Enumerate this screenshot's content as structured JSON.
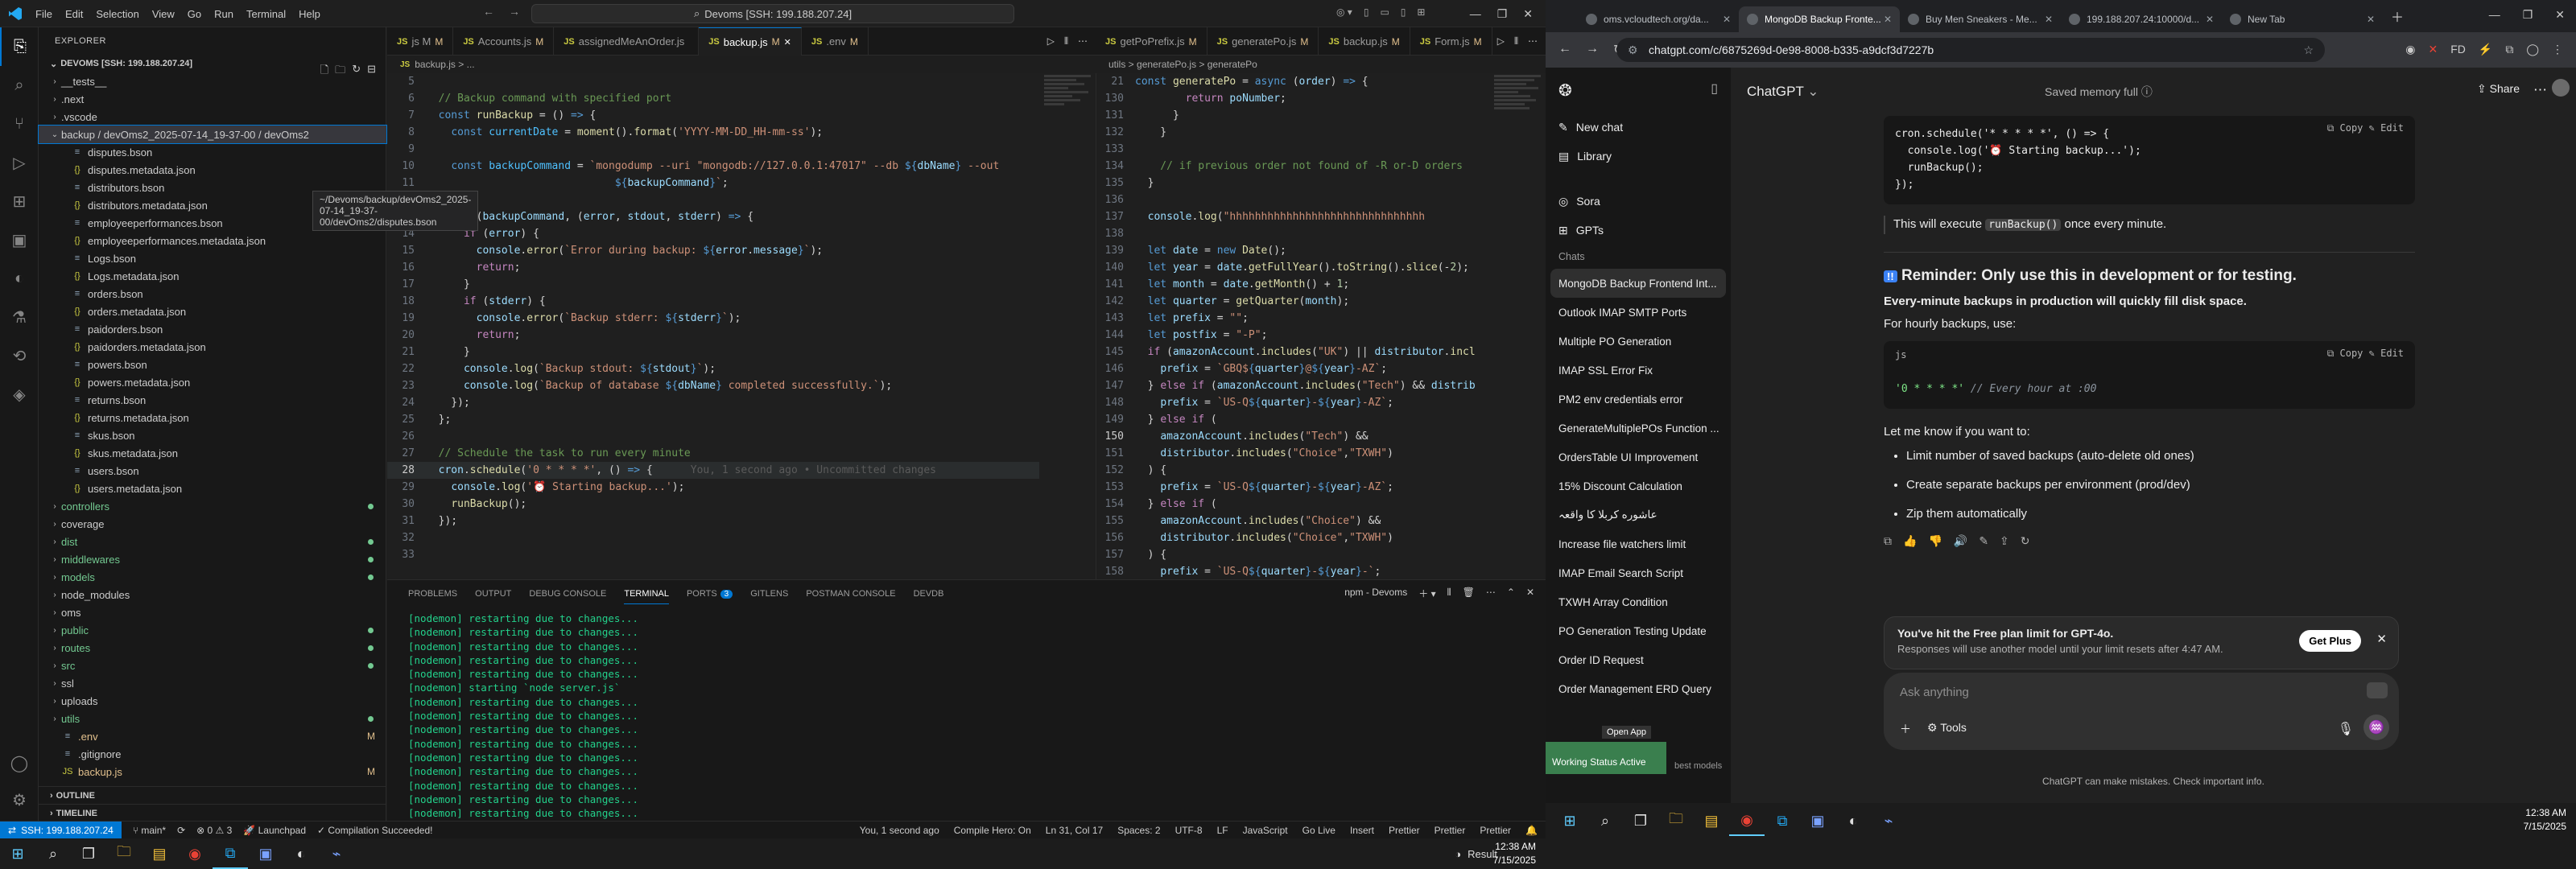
{
  "vscode": {
    "menu": [
      "File",
      "Edit",
      "Selection",
      "View",
      "Go",
      "Run",
      "Terminal",
      "Help"
    ],
    "command_center": "Devoms [SSH: 199.188.207.24]",
    "tabs": [
      {
        "label": "js M",
        "active": false,
        "mod": "M"
      },
      {
        "label": "Accounts.js",
        "active": false,
        "mod": "M"
      },
      {
        "label": "assignedMeAnOrder.js",
        "active": false,
        "mod": ""
      },
      {
        "label": "backup.js",
        "active": true,
        "mod": "M"
      },
      {
        "label": ".env",
        "active": false,
        "mod": "M"
      }
    ],
    "tabs_right": [
      {
        "label": "getPoPrefix.js",
        "mod": "M"
      },
      {
        "label": "generatePo.js",
        "mod": "M"
      },
      {
        "label": "backup.js",
        "mod": "M"
      },
      {
        "label": "Form.js",
        "mod": "M"
      }
    ],
    "breadcrumb_left": "backup.js > ...",
    "breadcrumb_right": "utils > generatePo.js > generatePo",
    "explorer": {
      "header": "EXPLORER",
      "root": "DEVOMS [SSH: 199.188.207.24]",
      "tooltip": "~/Devoms/backup/devOms2_2025-07-14_19-37-00/devOms2/disputes.bson",
      "items": [
        {
          "label": "__tests__",
          "indent": 1,
          "type": "folder",
          "status": ""
        },
        {
          "label": ".next",
          "indent": 1,
          "type": "folder",
          "status": ""
        },
        {
          "label": ".vscode",
          "indent": 1,
          "type": "folder",
          "status": ""
        },
        {
          "label": "backup / devOms2_2025-07-14_19-37-00 / devOms2",
          "indent": 1,
          "type": "open",
          "status": "",
          "selected": true
        },
        {
          "label": "disputes.bson",
          "indent": 2,
          "type": "file",
          "status": ""
        },
        {
          "label": "disputes.metadata.json",
          "indent": 2,
          "type": "file",
          "status": ""
        },
        {
          "label": "distributors.bson",
          "indent": 2,
          "type": "file",
          "status": ""
        },
        {
          "label": "distributors.metadata.json",
          "indent": 2,
          "type": "file",
          "status": ""
        },
        {
          "label": "employeeperformances.bson",
          "indent": 2,
          "type": "file",
          "status": ""
        },
        {
          "label": "employeeperformances.metadata.json",
          "indent": 2,
          "type": "file",
          "status": ""
        },
        {
          "label": "Logs.bson",
          "indent": 2,
          "type": "file",
          "status": ""
        },
        {
          "label": "Logs.metadata.json",
          "indent": 2,
          "type": "file",
          "status": ""
        },
        {
          "label": "orders.bson",
          "indent": 2,
          "type": "file",
          "status": ""
        },
        {
          "label": "orders.metadata.json",
          "indent": 2,
          "type": "file",
          "status": ""
        },
        {
          "label": "paidorders.bson",
          "indent": 2,
          "type": "file",
          "status": ""
        },
        {
          "label": "paidorders.metadata.json",
          "indent": 2,
          "type": "file",
          "status": ""
        },
        {
          "label": "powers.bson",
          "indent": 2,
          "type": "file",
          "status": ""
        },
        {
          "label": "powers.metadata.json",
          "indent": 2,
          "type": "file",
          "status": ""
        },
        {
          "label": "returns.bson",
          "indent": 2,
          "type": "file",
          "status": ""
        },
        {
          "label": "returns.metadata.json",
          "indent": 2,
          "type": "file",
          "status": ""
        },
        {
          "label": "skus.bson",
          "indent": 2,
          "type": "file",
          "status": ""
        },
        {
          "label": "skus.metadata.json",
          "indent": 2,
          "type": "file",
          "status": ""
        },
        {
          "label": "users.bson",
          "indent": 2,
          "type": "file",
          "status": ""
        },
        {
          "label": "users.metadata.json",
          "indent": 2,
          "type": "file",
          "status": ""
        },
        {
          "label": "controllers",
          "indent": 1,
          "type": "folder",
          "status": "dot"
        },
        {
          "label": "coverage",
          "indent": 1,
          "type": "folder",
          "status": ""
        },
        {
          "label": "dist",
          "indent": 1,
          "type": "folder",
          "status": "dot"
        },
        {
          "label": "middlewares",
          "indent": 1,
          "type": "folder",
          "status": "dot"
        },
        {
          "label": "models",
          "indent": 1,
          "type": "folder",
          "status": "dot"
        },
        {
          "label": "node_modules",
          "indent": 1,
          "type": "folder",
          "status": ""
        },
        {
          "label": "oms",
          "indent": 1,
          "type": "folder",
          "status": ""
        },
        {
          "label": "public",
          "indent": 1,
          "type": "folder",
          "status": "dot"
        },
        {
          "label": "routes",
          "indent": 1,
          "type": "folder",
          "status": "dot"
        },
        {
          "label": "src",
          "indent": 1,
          "type": "folder",
          "status": "dot"
        },
        {
          "label": "ssl",
          "indent": 1,
          "type": "folder",
          "status": ""
        },
        {
          "label": "uploads",
          "indent": 1,
          "type": "folder",
          "status": ""
        },
        {
          "label": "utils",
          "indent": 1,
          "type": "folder",
          "status": "dot"
        },
        {
          "label": ".env",
          "indent": 1,
          "type": "file",
          "status": "M"
        },
        {
          "label": ".gitignore",
          "indent": 1,
          "type": "file",
          "status": ""
        },
        {
          "label": "backup.js",
          "indent": 1,
          "type": "file",
          "status": "M"
        }
      ],
      "outline": "OUTLINE",
      "timeline": "TIMELINE"
    },
    "panel_tabs": [
      "PROBLEMS",
      "OUTPUT",
      "DEBUG CONSOLE",
      "TERMINAL",
      "PORTS",
      "GITLENS",
      "POSTMAN CONSOLE",
      "DEVDB"
    ],
    "ports_count": "3",
    "terminal_name": "npm - Devoms",
    "terminal_lines": [
      "[nodemon] restarting due to changes...",
      "[nodemon] restarting due to changes...",
      "[nodemon] restarting due to changes...",
      "[nodemon] restarting due to changes...",
      "[nodemon] restarting due to changes...",
      "[nodemon] starting `node server.js`",
      "[nodemon] restarting due to changes...",
      "[nodemon] restarting due to changes...",
      "[nodemon] restarting due to changes...",
      "[nodemon] restarting due to changes...",
      "[nodemon] restarting due to changes...",
      "[nodemon] restarting due to changes...",
      "[nodemon] restarting due to changes...",
      "[nodemon] restarting due to changes...",
      "[nodemon] restarting due to changes..."
    ],
    "status": {
      "remote": "SSH: 199.188.207.24",
      "branch": "main*",
      "errors": "0",
      "warnings": "3",
      "launchpad": "Launchpad",
      "compilation": "Compilation Succeeded!",
      "blame": "You, 1 second ago",
      "compile_hero": "Compile Hero: On",
      "position": "Ln 31, Col 17",
      "spaces": "Spaces: 2",
      "encoding": "UTF-8",
      "eol": "LF",
      "language": "JavaScript",
      "golive": "Go Live",
      "insert": "Insert",
      "prettier1": "Prettier",
      "prettier2": "Prettier",
      "prettier3": "Prettier"
    }
  },
  "chrome": {
    "tabs": [
      {
        "title": "oms.vcloudtech.org/da..."
      },
      {
        "title": "MongoDB Backup Fronte..."
      },
      {
        "title": "Buy Men Sneakers - Me..."
      },
      {
        "title": "199.188.207.24:10000/d..."
      },
      {
        "title": "New Tab"
      }
    ],
    "url": "chatgpt.com/c/6875269d-0e98-8008-b335-a9dcf3d7227b"
  },
  "chatgpt": {
    "sidebar_top": [
      {
        "label": "New chat",
        "icon": "edit-icon"
      },
      {
        "label": "Library",
        "icon": "library-icon"
      },
      {
        "label": "Sora",
        "icon": "sora-icon"
      },
      {
        "label": "GPTs",
        "icon": "gpts-icon"
      }
    ],
    "chats_heading": "Chats",
    "chats": [
      "MongoDB Backup Frontend Int...",
      "Outlook IMAP SMTP Ports",
      "Multiple PO Generation",
      "IMAP SSL Error Fix",
      "PM2 env credentials error",
      "GenerateMultiplePOs Function ...",
      "OrdersTable UI Improvement",
      "15% Discount Calculation",
      "عاشوره کربلا کا واقعہ",
      "Increase file watchers limit",
      "IMAP Email Search Script",
      "TXWH Array Condition",
      "PO Generation Testing Update",
      "Order ID Request",
      "Order Management ERD Query"
    ],
    "model": "ChatGPT",
    "memory": "Saved memory full",
    "share": "Share",
    "copy": "Copy",
    "edit": "Edit",
    "code1": [
      "cron.schedule('* * * * *', () => {",
      "  console.log('⏰ Starting backup...');",
      "  runBackup();",
      "});"
    ],
    "execute_pre": "This will execute",
    "execute_code": "runBackup()",
    "execute_post": "once every minute.",
    "reminder": "Reminder: Only use this in development or for testing.",
    "warning_bold": "Every-minute backups in production will quickly fill disk space.",
    "hourly": "For hourly backups, use:",
    "lang": "js",
    "code2_str": "'0 * * * *'",
    "code2_comment": "// Every hour at :00",
    "letme": "Let me know if you want to:",
    "bullets": [
      "Limit number of saved backups (auto-delete old ones)",
      "Create separate backups per environment (prod/dev)",
      "Zip them automatically"
    ],
    "limit_title": "You've hit the Free plan limit for GPT-4o.",
    "limit_body": "Responses will use another model until your limit resets after 4:47 AM.",
    "get_plus": "Get Plus",
    "placeholder": "Ask anything",
    "tools": "Tools",
    "disclaimer": "ChatGPT can make mistakes. Check important info.",
    "open_app": "Open App",
    "working_status": "Working Status Active",
    "best_models": "best models"
  },
  "taskbar": {
    "time": "12:38 AM",
    "date": "7/15/2025",
    "result": "Result"
  }
}
